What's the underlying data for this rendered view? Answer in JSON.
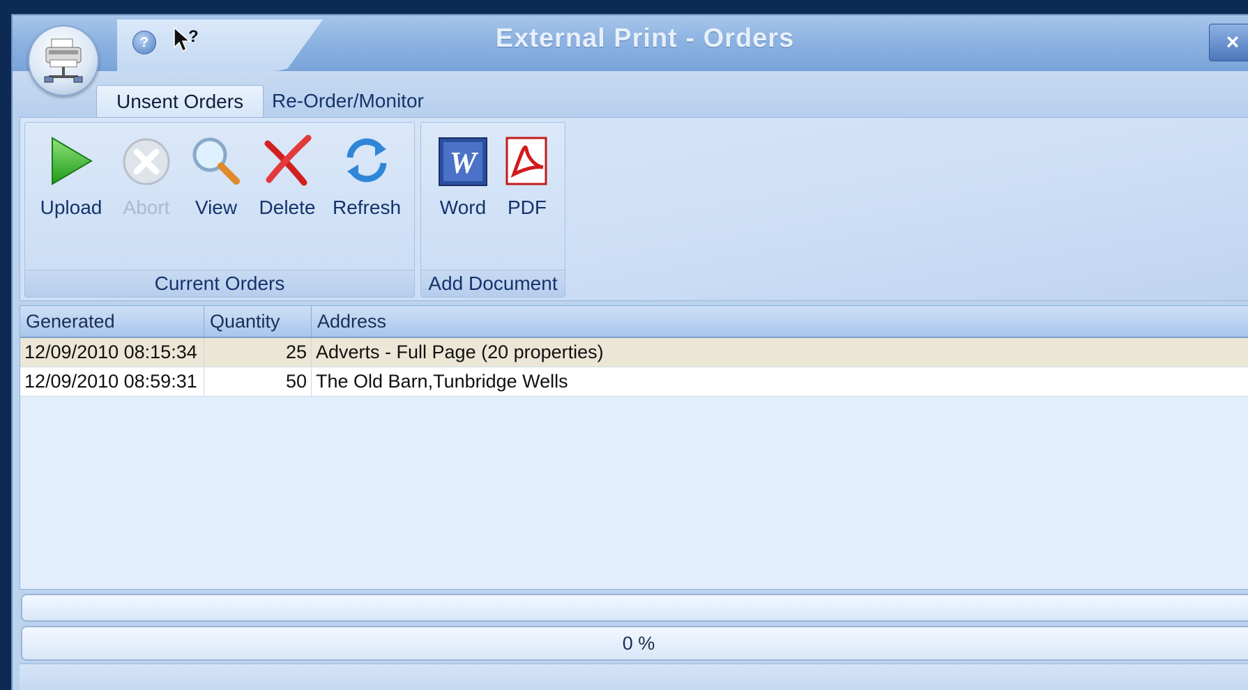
{
  "window": {
    "title": "External Print - Orders",
    "close_label": "×",
    "help_label": "?"
  },
  "tabs": [
    {
      "label": "Unsent Orders",
      "active": true
    },
    {
      "label": "Re-Order/Monitor",
      "active": false
    }
  ],
  "ribbon": {
    "groups": [
      {
        "label": "Current Orders",
        "buttons": [
          {
            "label": "Upload",
            "icon": "play-icon",
            "enabled": true
          },
          {
            "label": "Abort",
            "icon": "abort-icon",
            "enabled": false
          },
          {
            "label": "View",
            "icon": "magnifier-icon",
            "enabled": true
          },
          {
            "label": "Delete",
            "icon": "delete-x-icon",
            "enabled": true
          },
          {
            "label": "Refresh",
            "icon": "refresh-icon",
            "enabled": true
          }
        ]
      },
      {
        "label": "Add Document",
        "buttons": [
          {
            "label": "Word",
            "icon": "word-icon",
            "enabled": true
          },
          {
            "label": "PDF",
            "icon": "pdf-icon",
            "enabled": true
          }
        ]
      }
    ]
  },
  "table": {
    "columns": [
      "Generated",
      "Quantity",
      "Address"
    ],
    "rows": [
      {
        "generated": "12/09/2010 08:15:34",
        "quantity": "25",
        "address": "Adverts - Full Page (20 properties)",
        "selected": true
      },
      {
        "generated": "12/09/2010 08:59:31",
        "quantity": "50",
        "address": "The Old Barn,Tunbridge Wells",
        "selected": false
      }
    ]
  },
  "progress": {
    "upload_fraction": 0,
    "overall_label": "0 %"
  },
  "colors": {
    "accent": "#7aa4d9",
    "selected_row": "#ece6d6"
  }
}
